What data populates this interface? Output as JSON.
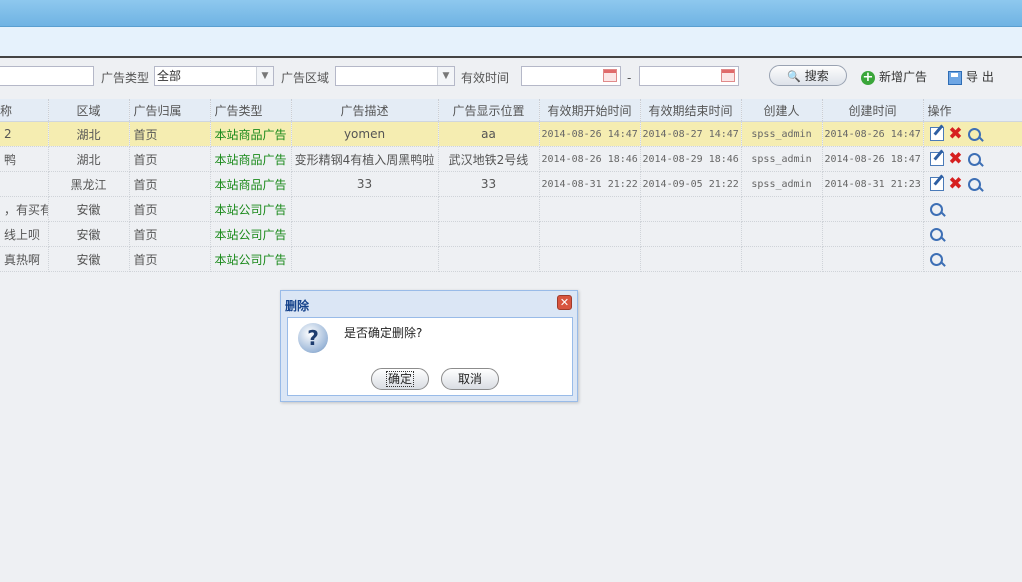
{
  "toolbar": {
    "ad_type_label": "广告类型",
    "ad_type_value": "全部",
    "ad_region_label": "广告区域",
    "ad_region_value": "",
    "valid_time_label": "有效时间",
    "date_separator": "-",
    "search_label": "搜索",
    "add_label": "新增广告",
    "export_label": "导 出"
  },
  "table": {
    "headers": [
      "称",
      "区域",
      "广告归属",
      "广告类型",
      "广告描述",
      "广告显示位置",
      "有效期开始时间",
      "有效期结束时间",
      "创建人",
      "创建时间",
      "操作"
    ],
    "rows": [
      {
        "name": "2",
        "region": "湖北",
        "owner": "首页",
        "type": "本站商品广告",
        "desc": "yomen",
        "position": "aa",
        "start": "2014-08-26 14:47",
        "end": "2014-08-27 14:47",
        "creator": "spss_admin",
        "created": "2014-08-26 14:47",
        "selected": true,
        "editable": true
      },
      {
        "name": "鸭",
        "region": "湖北",
        "owner": "首页",
        "type": "本站商品广告",
        "desc": "变形精钢4有植入周黑鸭啦",
        "position": "武汉地铁2号线",
        "start": "2014-08-26 18:46",
        "end": "2014-08-29 18:46",
        "creator": "spss_admin",
        "created": "2014-08-26 18:47",
        "selected": false,
        "editable": true
      },
      {
        "name": "",
        "region": "黑龙江",
        "owner": "首页",
        "type": "本站商品广告",
        "desc": "33",
        "position": "33",
        "start": "2014-08-31 21:22",
        "end": "2014-09-05 21:22",
        "creator": "spss_admin",
        "created": "2014-08-31 21:23",
        "selected": false,
        "editable": true
      },
      {
        "name": "，有买有送",
        "region": "安徽",
        "owner": "首页",
        "type": "本站公司广告",
        "desc": "",
        "position": "",
        "start": "",
        "end": "",
        "creator": "",
        "created": "",
        "selected": false,
        "editable": false
      },
      {
        "name": "线上呗",
        "region": "安徽",
        "owner": "首页",
        "type": "本站公司广告",
        "desc": "",
        "position": "",
        "start": "",
        "end": "",
        "creator": "",
        "created": "",
        "selected": false,
        "editable": false
      },
      {
        "name": "真热啊",
        "region": "安徽",
        "owner": "首页",
        "type": "本站公司广告",
        "desc": "",
        "position": "",
        "start": "",
        "end": "",
        "creator": "",
        "created": "",
        "selected": false,
        "editable": false
      }
    ]
  },
  "dialog": {
    "title": "删除",
    "close_glyph": "✕",
    "message": "是否确定删除?",
    "ok_label": "确定",
    "cancel_label": "取消"
  },
  "icons": {
    "question": "?",
    "dropdown": "▼",
    "search": "🔍",
    "plus": "+",
    "delete": "✖"
  }
}
